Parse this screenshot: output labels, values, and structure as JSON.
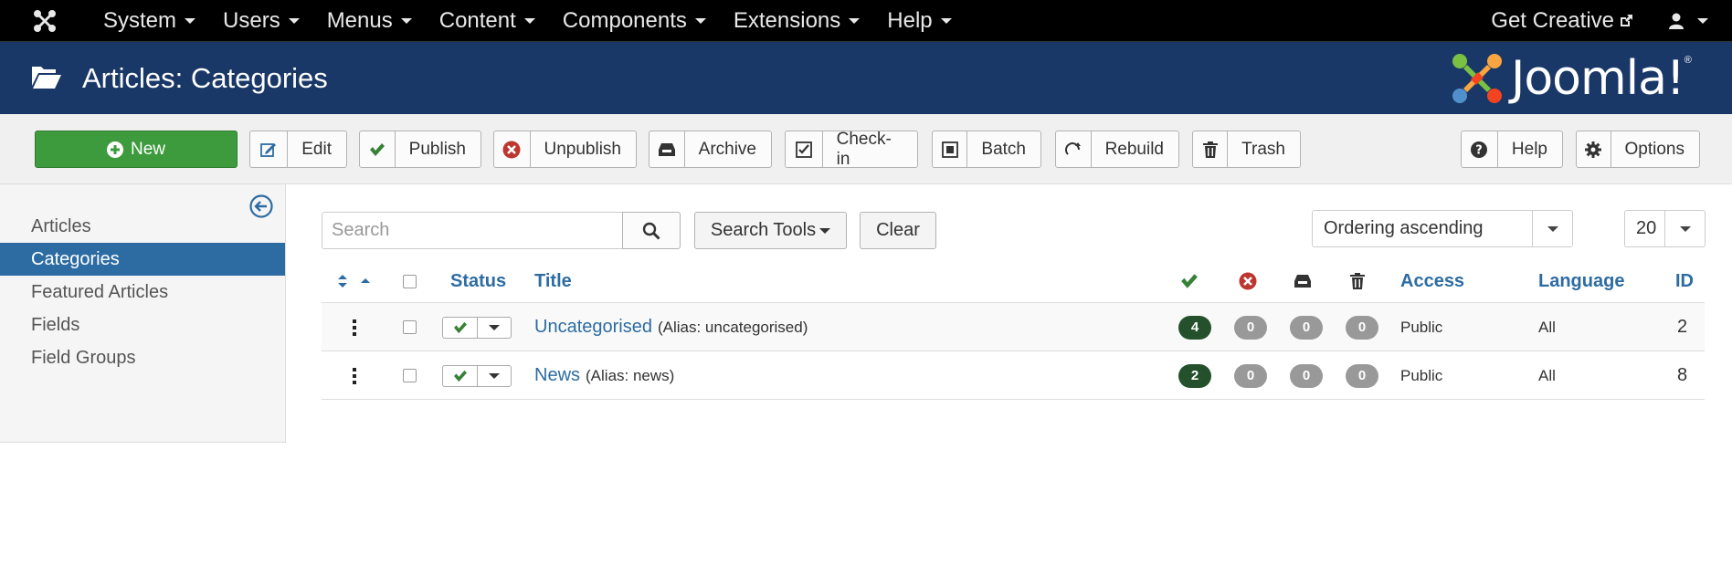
{
  "topbar": {
    "menu": [
      "System",
      "Users",
      "Menus",
      "Content",
      "Components",
      "Extensions",
      "Help"
    ],
    "get_creative": "Get Creative"
  },
  "header": {
    "title": "Articles: Categories",
    "brand": "Joomla!",
    "brand_reg": "®"
  },
  "toolbar": {
    "new": "New",
    "edit": "Edit",
    "publish": "Publish",
    "unpublish": "Unpublish",
    "archive": "Archive",
    "checkin": "Check-in",
    "batch": "Batch",
    "rebuild": "Rebuild",
    "trash": "Trash",
    "help": "Help",
    "options": "Options"
  },
  "sidebar": {
    "items": [
      "Articles",
      "Categories",
      "Featured Articles",
      "Fields",
      "Field Groups"
    ],
    "active_index": 1
  },
  "filters": {
    "search_placeholder": "Search",
    "search_tools": "Search Tools",
    "clear": "Clear",
    "ordering": "Ordering ascending",
    "limit": "20"
  },
  "table": {
    "headers": {
      "status": "Status",
      "title": "Title",
      "access": "Access",
      "language": "Language",
      "id": "ID"
    },
    "rows": [
      {
        "title": "Uncategorised",
        "alias": "(Alias: uncategorised)",
        "published": "4",
        "unpublished": "0",
        "archived": "0",
        "trashed": "0",
        "access": "Public",
        "language": "All",
        "id": "2"
      },
      {
        "title": "News",
        "alias": "(Alias: news)",
        "published": "2",
        "unpublished": "0",
        "archived": "0",
        "trashed": "0",
        "access": "Public",
        "language": "All",
        "id": "8"
      }
    ]
  },
  "colors": {
    "navbar": "#000000",
    "header": "#1a3867",
    "link": "#2d6ca2",
    "new_button": "#3d9a3d",
    "published_badge": "#24512b"
  }
}
